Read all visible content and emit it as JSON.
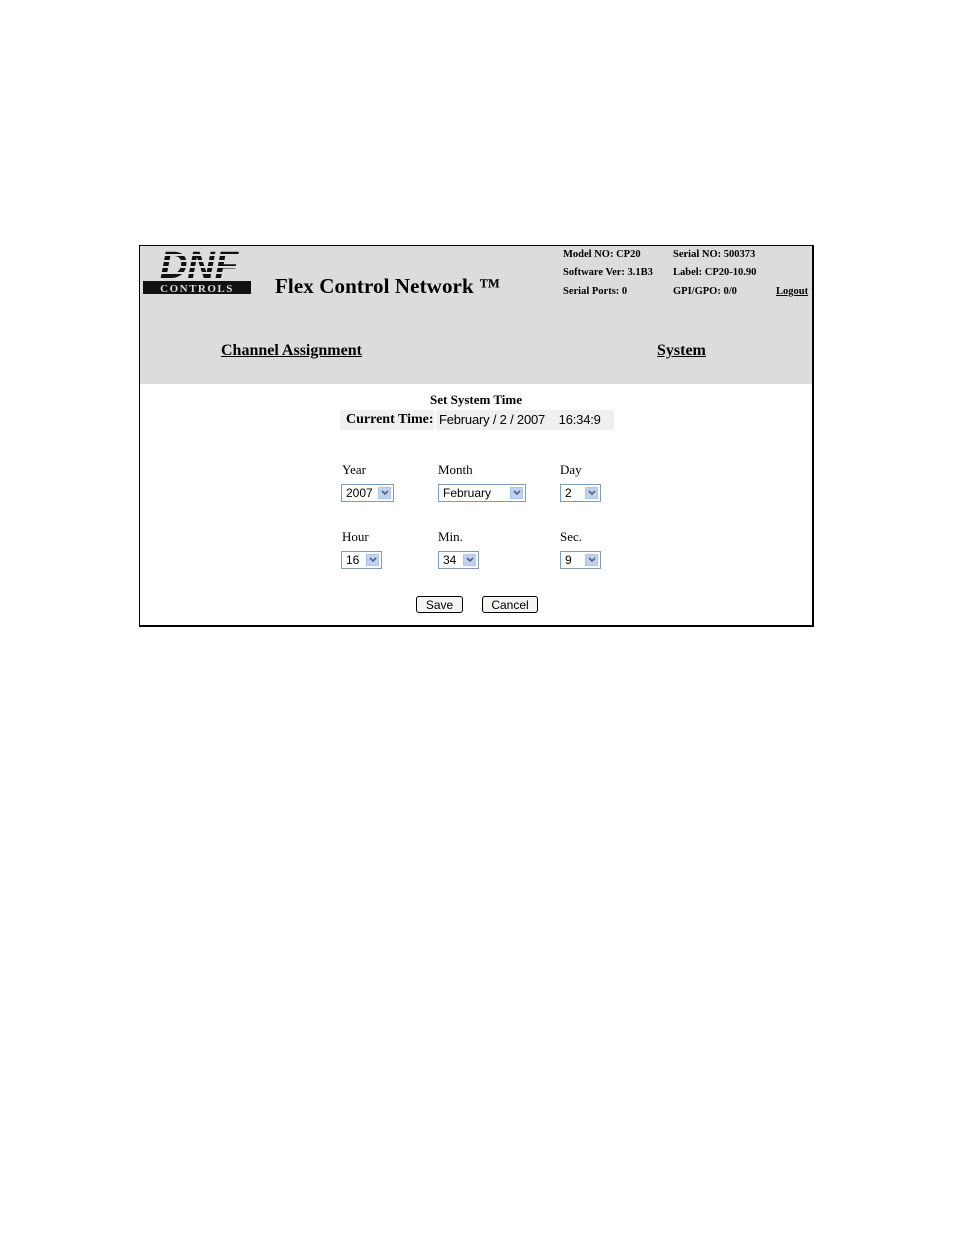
{
  "header": {
    "logo_text_top": "DNF",
    "logo_text_bottom": "CONTROLS",
    "app_title": "Flex Control Network ™",
    "info": {
      "model": "Model NO: CP20",
      "serial": "Serial NO: 500373",
      "software": "Software Ver: 3.1B3",
      "label": "Label: CP20-10.90",
      "serial_ports": "Serial Ports: 0",
      "gpi_gpo": "GPI/GPO: 0/0"
    },
    "logout": "Logout"
  },
  "nav": {
    "channel_assignment": "Channel Assignment",
    "system": "System"
  },
  "main": {
    "title": "Set System Time",
    "current_time_label": "Current Time:",
    "current_time_value": "February / 2 / 2007    16:34:9",
    "fields": {
      "year": {
        "label": "Year",
        "value": "2007"
      },
      "month": {
        "label": "Month",
        "value": "February"
      },
      "day": {
        "label": "Day",
        "value": "2"
      },
      "hour": {
        "label": "Hour",
        "value": "16"
      },
      "min": {
        "label": "Min.",
        "value": "34"
      },
      "sec": {
        "label": "Sec.",
        "value": "9"
      }
    },
    "save_label": "Save",
    "cancel_label": "Cancel"
  },
  "icons": {
    "select_arrow": "chevron-down-icon"
  }
}
